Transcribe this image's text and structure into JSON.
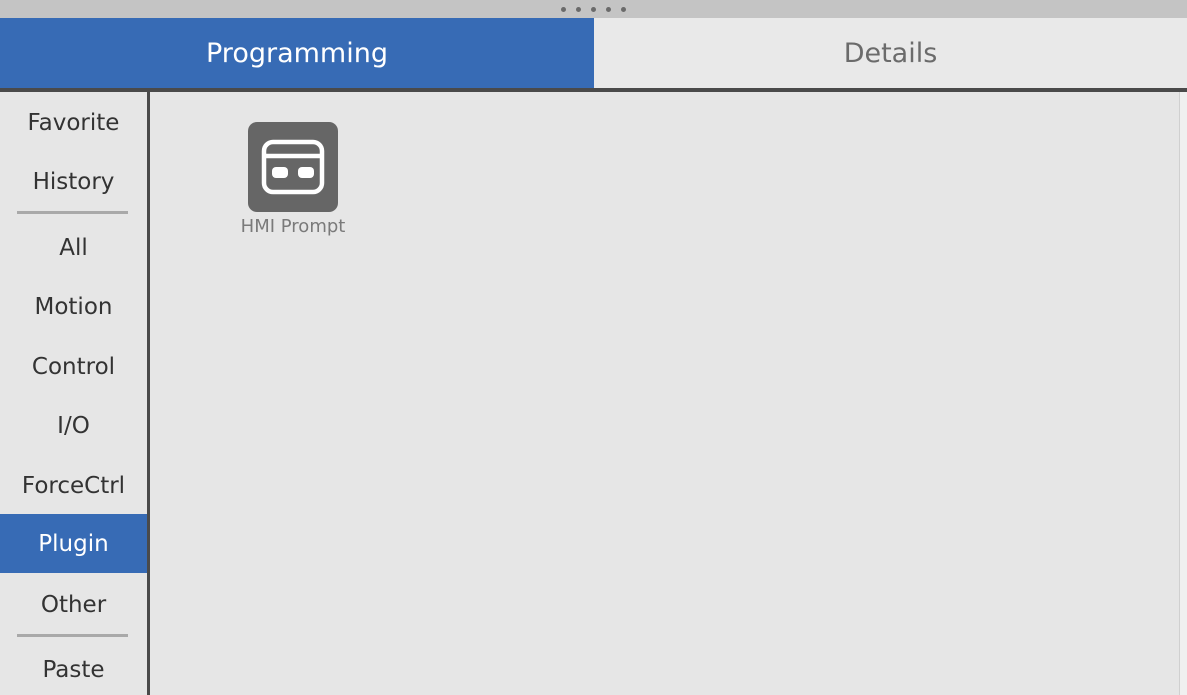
{
  "tabs": {
    "programming": "Programming",
    "details": "Details"
  },
  "sidebar": {
    "favorite": "Favorite",
    "history": "History",
    "all": "All",
    "motion": "Motion",
    "control": "Control",
    "io": "I/O",
    "forcectrl": "ForceCtrl",
    "plugin": "Plugin",
    "other": "Other",
    "paste": "Paste",
    "selected": "Plugin"
  },
  "main": {
    "items": [
      {
        "label": "HMI Prompt",
        "icon": "hmi-prompt-icon"
      }
    ]
  },
  "colors": {
    "accent": "#376bb5",
    "icon_bg": "#666666"
  }
}
